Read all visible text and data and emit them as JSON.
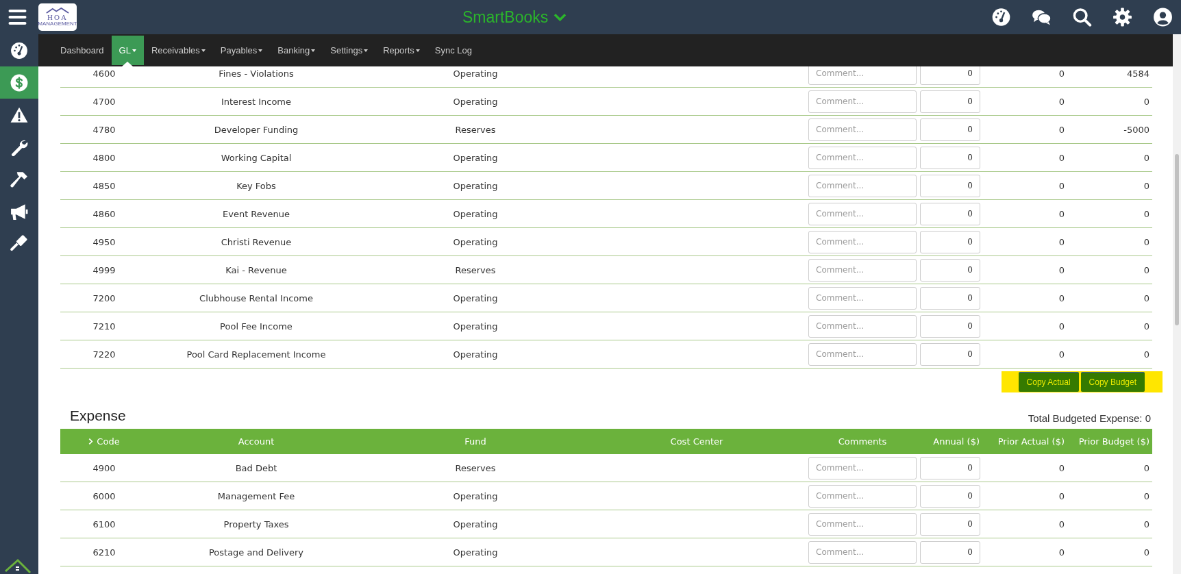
{
  "topbar": {
    "logo": {
      "text": "HOA",
      "subtext": "MANAGEMENT"
    },
    "title": "SmartBooks",
    "icons": [
      {
        "kind": "gauge"
      },
      {
        "kind": "chat"
      },
      {
        "kind": "search"
      },
      {
        "kind": "settings"
      },
      {
        "kind": "user"
      }
    ]
  },
  "sidebar": {
    "items": [
      {
        "kind": "gauge",
        "selected": false
      },
      {
        "kind": "dollar",
        "selected": true
      },
      {
        "kind": "warning",
        "selected": false
      },
      {
        "kind": "wrench",
        "selected": false
      },
      {
        "kind": "hammer",
        "selected": false
      },
      {
        "kind": "megaphone",
        "selected": false
      },
      {
        "kind": "gavel",
        "selected": false
      }
    ]
  },
  "nav": [
    {
      "label": "Dashboard",
      "dropdown": false,
      "selected": false
    },
    {
      "label": "GL",
      "dropdown": true,
      "selected": true
    },
    {
      "label": "Receivables",
      "dropdown": true,
      "selected": false
    },
    {
      "label": "Payables",
      "dropdown": true,
      "selected": false
    },
    {
      "label": "Banking",
      "dropdown": true,
      "selected": false
    },
    {
      "label": "Settings",
      "dropdown": true,
      "selected": false
    },
    {
      "label": "Reports",
      "dropdown": true,
      "selected": false
    },
    {
      "label": "Sync Log",
      "dropdown": false,
      "selected": false
    }
  ],
  "income": {
    "rows": [
      {
        "code": "4600",
        "account": "Fines - Violations",
        "fund": "Operating",
        "comment_placeholder": "Comment...",
        "annual": "0",
        "prior_actual": "0",
        "prior_budget": "4584"
      },
      {
        "code": "4700",
        "account": "Interest Income",
        "fund": "Operating",
        "comment_placeholder": "Comment...",
        "annual": "0",
        "prior_actual": "0",
        "prior_budget": "0"
      },
      {
        "code": "4780",
        "account": "Developer Funding",
        "fund": "Reserves",
        "comment_placeholder": "Comment...",
        "annual": "0",
        "prior_actual": "0",
        "prior_budget": "-5000"
      },
      {
        "code": "4800",
        "account": "Working Capital",
        "fund": "Operating",
        "comment_placeholder": "Comment...",
        "annual": "0",
        "prior_actual": "0",
        "prior_budget": "0"
      },
      {
        "code": "4850",
        "account": "Key Fobs",
        "fund": "Operating",
        "comment_placeholder": "Comment...",
        "annual": "0",
        "prior_actual": "0",
        "prior_budget": "0"
      },
      {
        "code": "4860",
        "account": "Event Revenue",
        "fund": "Operating",
        "comment_placeholder": "Comment...",
        "annual": "0",
        "prior_actual": "0",
        "prior_budget": "0"
      },
      {
        "code": "4950",
        "account": "Christi Revenue",
        "fund": "Operating",
        "comment_placeholder": "Comment...",
        "annual": "0",
        "prior_actual": "0",
        "prior_budget": "0"
      },
      {
        "code": "4999",
        "account": "Kai - Revenue",
        "fund": "Reserves",
        "comment_placeholder": "Comment...",
        "annual": "0",
        "prior_actual": "0",
        "prior_budget": "0"
      },
      {
        "code": "7200",
        "account": "Clubhouse Rental Income",
        "fund": "Operating",
        "comment_placeholder": "Comment...",
        "annual": "0",
        "prior_actual": "0",
        "prior_budget": "0"
      },
      {
        "code": "7210",
        "account": "Pool Fee Income",
        "fund": "Operating",
        "comment_placeholder": "Comment...",
        "annual": "0",
        "prior_actual": "0",
        "prior_budget": "0"
      },
      {
        "code": "7220",
        "account": "Pool Card Replacement Income",
        "fund": "Operating",
        "comment_placeholder": "Comment...",
        "annual": "0",
        "prior_actual": "0",
        "prior_budget": "0"
      }
    ],
    "buttons": [
      "Copy Actual",
      "Copy Budget"
    ]
  },
  "expense": {
    "title": "Expense",
    "total": "Total Budgeted Expense: 0",
    "columns": [
      "Code",
      "Account",
      "Fund",
      "Cost Center",
      "Comments",
      "Annual ($)",
      "Prior Actual ($)",
      "Prior Budget ($)"
    ],
    "rows": [
      {
        "code": "4900",
        "account": "Bad Debt",
        "fund": "Reserves",
        "comment_placeholder": "Comment...",
        "annual": "0",
        "prior_actual": "0",
        "prior_budget": "0"
      },
      {
        "code": "6000",
        "account": "Management Fee",
        "fund": "Operating",
        "comment_placeholder": "Comment...",
        "annual": "0",
        "prior_actual": "0",
        "prior_budget": "0"
      },
      {
        "code": "6100",
        "account": "Property Taxes",
        "fund": "Operating",
        "comment_placeholder": "Comment...",
        "annual": "0",
        "prior_actual": "0",
        "prior_budget": "0"
      },
      {
        "code": "6210",
        "account": "Postage and Delivery",
        "fund": "Operating",
        "comment_placeholder": "Comment...",
        "annual": "0",
        "prior_actual": "0",
        "prior_budget": "0"
      }
    ]
  }
}
